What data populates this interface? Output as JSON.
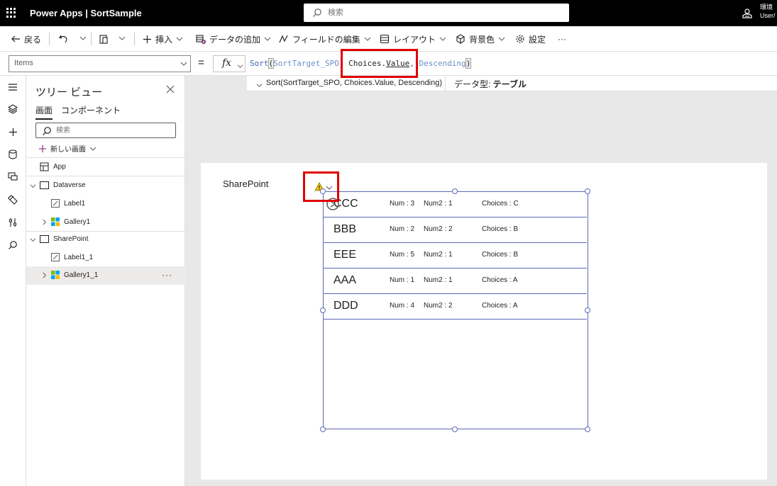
{
  "header": {
    "app_title": "Power Apps | SortSample",
    "search_placeholder": "検索",
    "environment_line1": "環境",
    "environment_line2": "User/"
  },
  "commandbar": {
    "back": "戻る",
    "insert": "挿入",
    "add_data": "データの追加",
    "edit_fields": "フィールドの編集",
    "layout": "レイアウト",
    "background": "背景色",
    "settings": "設定",
    "more": "···"
  },
  "formulabar": {
    "property": "Items",
    "equals": "=",
    "fx": "fx",
    "formula": {
      "fn": "Sort",
      "open": "(",
      "datasource": "SortTarget_SPO",
      "comma1": ", ",
      "field_prefix": "Choices.",
      "field_value": "Value",
      "comma2": ", ",
      "order": "Descending",
      "close": ")"
    },
    "hint_signature": "Sort(SortTarget_SPO, Choices.Value, Descending)",
    "hint_type_label": "データ型: ",
    "hint_type_value": "テーブル"
  },
  "tree": {
    "title": "ツリー ビュー",
    "tabs": [
      {
        "label": "画面",
        "active": true
      },
      {
        "label": "コンポーネント",
        "active": false
      }
    ],
    "search_placeholder": "検索",
    "new_screen": "新しい画面",
    "nodes": [
      {
        "label": "App"
      },
      {
        "label": "Dataverse"
      },
      {
        "label": "Label1"
      },
      {
        "label": "Gallery1"
      },
      {
        "label": "SharePoint"
      },
      {
        "label": "Label1_1"
      },
      {
        "label": "Gallery1_1",
        "selected": true
      }
    ],
    "more": "···"
  },
  "canvas": {
    "label": "SharePoint",
    "gallery": [
      {
        "title": "CCC",
        "num": "Num : 3",
        "num2": "Num2 : 1",
        "choices": "Choices : C"
      },
      {
        "title": "BBB",
        "num": "Num : 2",
        "num2": "Num2 : 2",
        "choices": "Choices : B"
      },
      {
        "title": "EEE",
        "num": "Num : 5",
        "num2": "Num2 : 1",
        "choices": "Choices : B"
      },
      {
        "title": "AAA",
        "num": "Num : 1",
        "num2": "Num2 : 1",
        "choices": "Choices : A"
      },
      {
        "title": "DDD",
        "num": "Num : 4",
        "num2": "Num2 : 2",
        "choices": "Choices : A"
      }
    ]
  },
  "colors": {
    "accent": "#742774",
    "selection": "#5e68b8",
    "highlight": "#e00000",
    "warning": "#f2c811"
  },
  "icons": [
    "waffle-icon",
    "search-icon",
    "environment-icon",
    "back-arrow-icon",
    "undo-icon",
    "paste-icon",
    "plus-icon",
    "add-data-icon",
    "edit-fields-icon",
    "layout-icon",
    "background-icon",
    "gear-icon",
    "warning-icon",
    "close-icon",
    "hamburger-icon",
    "layers-icon",
    "database-icon",
    "media-icon",
    "tools-icon",
    "variables-icon"
  ]
}
